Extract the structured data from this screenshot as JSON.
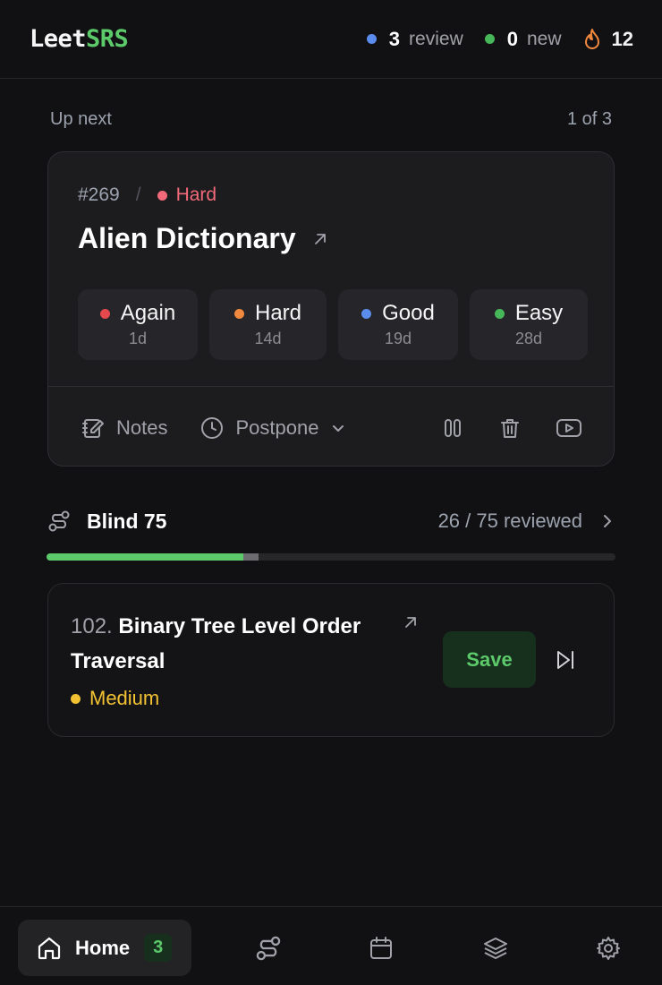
{
  "header": {
    "logo_part1": "Leet",
    "logo_part2": "SRS",
    "review_count": "3",
    "review_label": "review",
    "new_count": "0",
    "new_label": "new",
    "streak": "12"
  },
  "up_next": {
    "label": "Up next",
    "position": "1 of 3"
  },
  "current_card": {
    "problem_id": "#269",
    "separator": "/",
    "difficulty": "Hard",
    "title": "Alien Dictionary",
    "ratings": [
      {
        "label": "Again",
        "interval": "1d",
        "color": "#e5484d"
      },
      {
        "label": "Hard",
        "interval": "14d",
        "color": "#f0883e"
      },
      {
        "label": "Good",
        "interval": "19d",
        "color": "#5b8def"
      },
      {
        "label": "Easy",
        "interval": "28d",
        "color": "#46b85a"
      }
    ],
    "notes_label": "Notes",
    "postpone_label": "Postpone"
  },
  "list": {
    "name": "Blind 75",
    "progress_text": "26 / 75 reviewed",
    "reviewed": 26,
    "pending": 2,
    "total": 75
  },
  "next_problem": {
    "number": "102.",
    "title": "Binary Tree Level Order Traversal",
    "difficulty": "Medium",
    "save_label": "Save"
  },
  "nav": {
    "home_label": "Home",
    "home_badge": "3"
  },
  "colors": {
    "accent_green": "#5cc96a",
    "review_dot": "#5b8def",
    "new_dot": "#46b85a",
    "hard": "#f26a7a",
    "medium": "#f2c233",
    "streak": "#f0883e"
  }
}
